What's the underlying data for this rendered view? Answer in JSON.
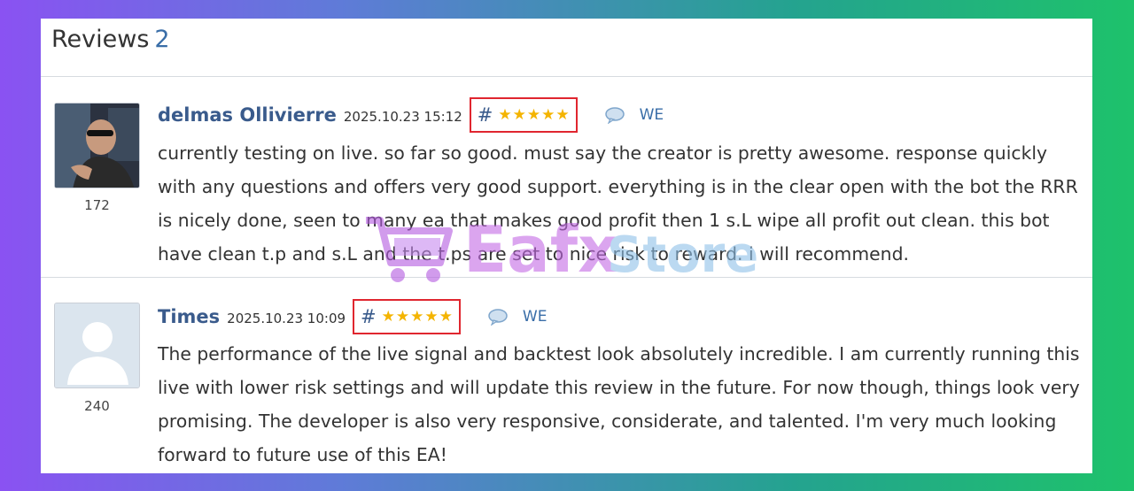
{
  "reviews_section": {
    "title": "Reviews",
    "count": "2"
  },
  "reviews": [
    {
      "author": "delmas Ollivierre",
      "date": "2025.10.23 15:12",
      "hash": "#",
      "rating": 5,
      "reply_label": "WE",
      "avatar_count": "172",
      "text": "currently testing on live. so far so good. must say the creator is pretty awesome. response quickly with any questions and offers very good support. everything is in the clear open with the bot the RRR is nicely done, seen to many ea that makes good profit then 1 s.L wipe all profit out clean. this bot have clean t.p and s.L and the t.ps are set to nice risk to reward. i will recommend."
    },
    {
      "author": "Times",
      "date": "2025.10.23 10:09",
      "hash": "#",
      "rating": 5,
      "reply_label": "WE",
      "avatar_count": "240",
      "text": "The performance of the live signal and backtest look absolutely incredible. I am currently running this live with lower risk settings and will update this review in the future. For now though, things look very promising. The developer is also very responsive, considerate, and talented. I'm very much looking forward to future use of this EA!"
    }
  ],
  "watermark": {
    "brand_a": "Eafx",
    "brand_b": "Store"
  },
  "colors": {
    "accent": "#3a5b8c",
    "link": "#3a6ea8",
    "star": "#f4b400",
    "highlight_box": "#e0262f"
  },
  "icons": {
    "star": "star-icon",
    "reply": "chat-bubble-icon",
    "cart": "cart-icon"
  }
}
